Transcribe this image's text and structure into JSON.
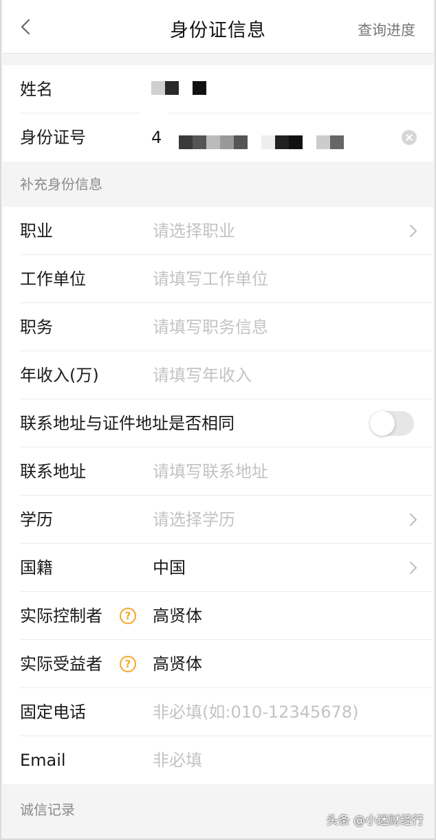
{
  "header": {
    "title": "身份证信息",
    "progress_link": "查询进度"
  },
  "identity": {
    "name_label": "姓名",
    "id_label": "身份证号",
    "id_value_prefix": "4"
  },
  "supplement_section": "补充身份信息",
  "fields": {
    "occupation": {
      "label": "职业",
      "placeholder": "请选择职业"
    },
    "employer": {
      "label": "工作单位",
      "placeholder": "请填写工作单位"
    },
    "position": {
      "label": "职务",
      "placeholder": "请填写职务信息"
    },
    "income": {
      "label": "年收入(万)",
      "placeholder": "请填写年收入"
    },
    "same_address": {
      "label": "联系地址与证件地址是否相同",
      "enabled": false
    },
    "address": {
      "label": "联系地址",
      "placeholder": "请填写联系地址"
    },
    "education": {
      "label": "学历",
      "placeholder": "请选择学历"
    },
    "nationality": {
      "label": "国籍",
      "value": "中国"
    },
    "controller": {
      "label": "实际控制者",
      "help": "?",
      "value": "高贤体"
    },
    "beneficiary": {
      "label": "实际受益者",
      "help": "?",
      "value": "高贤体"
    },
    "landline": {
      "label": "固定电话",
      "placeholder": "非必填(如:010-12345678)"
    },
    "email": {
      "label": "Email",
      "placeholder": "非必填"
    }
  },
  "credit_section": "诚信记录",
  "watermark": "头条 @小迷财经行",
  "colors": {
    "accent": "#f5a623",
    "placeholder": "#c3c3c3",
    "background": "#f4f4f4"
  },
  "icons": {
    "back": "chevron-left-icon",
    "chevron": "chevron-right-icon",
    "clear": "clear-icon",
    "help": "question-circle-icon"
  }
}
